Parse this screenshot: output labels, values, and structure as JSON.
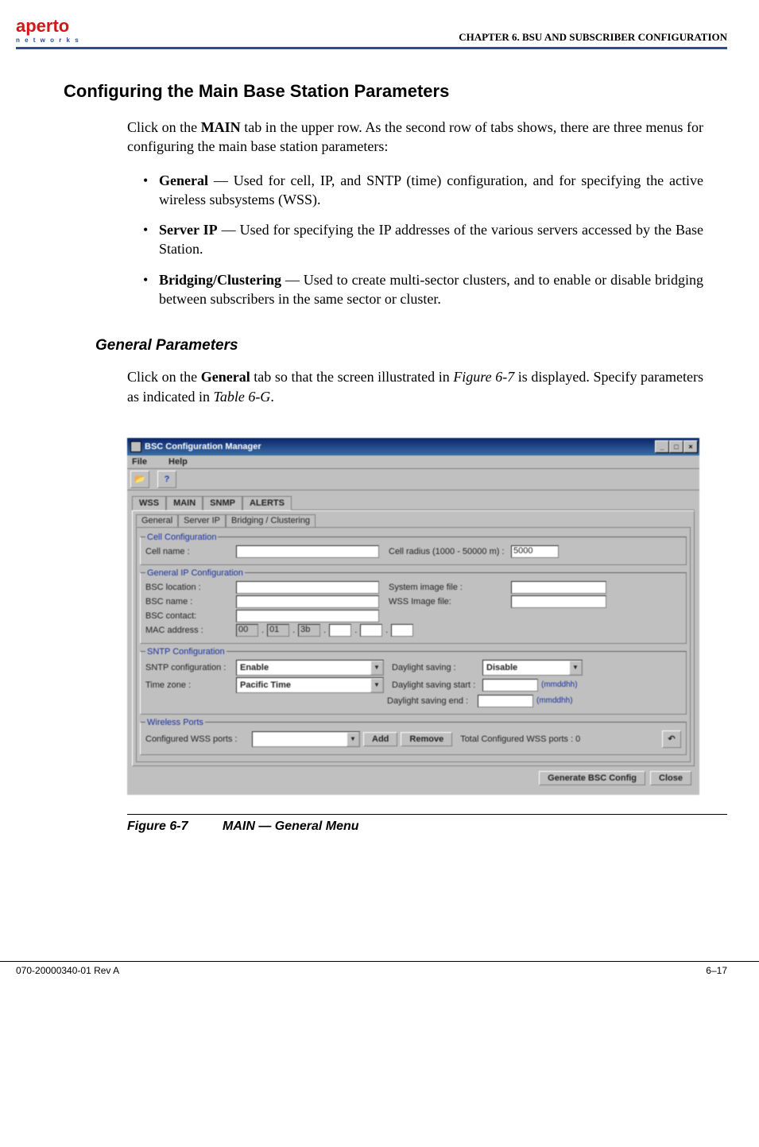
{
  "header": {
    "logo_red": "aperto",
    "logo_sub": "n e t w o r k s",
    "chapter_label": "CHAPTER 6.   BSU AND SUBSCRIBER CONFIGURATION"
  },
  "section_title": "Configuring the Main Base Station Parameters",
  "intro_before_bold": "Click on the ",
  "intro_bold": "MAIN",
  "intro_after_bold": " tab in the upper row. As the second row of tabs shows, there are three menus for configuring the main base station parameters:",
  "bullets": [
    {
      "bold": "General",
      "rest": " — Used for cell, IP, and SNTP (time) configuration, and for specifying the active wireless subsystems (WSS)."
    },
    {
      "bold": "Server IP",
      "rest": " — Used for specifying the IP addresses of the various servers accessed by the Base Station."
    },
    {
      "bold": "Bridging/Clustering",
      "rest": " — Used to create multi-sector clusters, and to enable or disable bridging between subscribers in the same sector or cluster."
    }
  ],
  "subhead": "General Parameters",
  "para2_a": "Click on the ",
  "para2_bold": "General",
  "para2_b": " tab so that the screen illustrated in ",
  "para2_fig": "Figure 6-7",
  "para2_c": " is displayed. Specify parameters as indicated in ",
  "para2_tbl": "Table 6-G",
  "para2_d": ".",
  "app": {
    "title": "BSC Configuration Manager",
    "menu_file": "File",
    "menu_help": "Help",
    "tool_open": "📂",
    "tool_help": "?",
    "tabs": {
      "wss": "WSS",
      "main": "MAIN",
      "snmp": "SNMP",
      "alerts": "ALERTS"
    },
    "subtabs": {
      "general": "General",
      "serverip": "Server IP",
      "bridging": "Bridging / Clustering"
    },
    "groups": {
      "cell": {
        "legend": "Cell Configuration",
        "cellname_lbl": "Cell name :",
        "cellradius_lbl": "Cell radius (1000 - 50000 m) :",
        "cellradius_val": "5000"
      },
      "ip": {
        "legend": "General IP Configuration",
        "loc_lbl": "BSC location :",
        "name_lbl": "BSC name :",
        "contact_lbl": "BSC contact:",
        "mac_lbl": "MAC address :",
        "sysimg_lbl": "System image file :",
        "wssimg_lbl": "WSS Image file:",
        "mac1": "00",
        "mac2": "01",
        "mac3": "3b"
      },
      "sntp": {
        "legend": "SNTP Configuration",
        "conf_lbl": "SNTP configuration :",
        "conf_val": "Enable",
        "tz_lbl": "Time zone :",
        "tz_val": "Pacific Time",
        "ds_lbl": "Daylight saving :",
        "ds_val": "Disable",
        "dsstart_lbl": "Daylight saving start :",
        "dsend_lbl": "Daylight saving end :",
        "hint": "(mmddhh)"
      },
      "wireless": {
        "legend": "Wireless Ports",
        "conf_lbl": "Configured WSS ports :",
        "add_btn": "Add",
        "remove_btn": "Remove",
        "total_lbl": "Total  Configured WSS ports : 0"
      }
    },
    "gen_btn": "Generate BSC Config",
    "close_btn": "Close"
  },
  "figure": {
    "num": "Figure 6-7",
    "caption": "MAIN — General Menu"
  },
  "footer": {
    "left": "070-20000340-01 Rev A",
    "right": "6–17"
  }
}
